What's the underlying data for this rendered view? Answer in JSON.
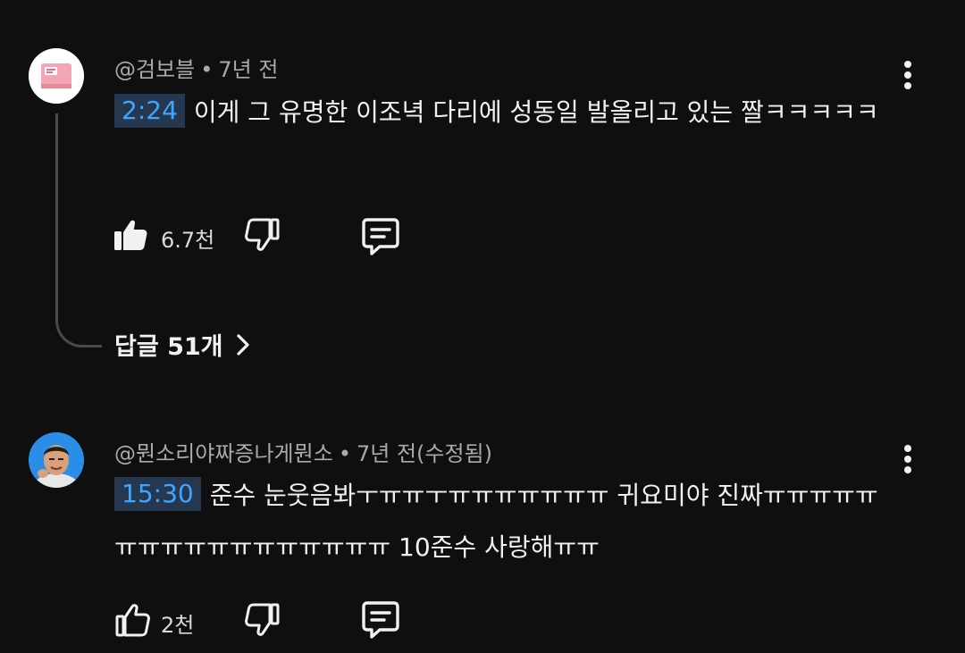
{
  "comments": [
    {
      "handle": "@검보블",
      "separator": "•",
      "age": "7년 전",
      "timestamp": "2:24",
      "text": "이게 그 유명한 이조녁 다리에 성동일 발올리고 있는 짤ㅋㅋㅋㅋㅋ",
      "likes": "6.7천",
      "like_icon": "thumbs-up-filled-icon",
      "replies_label": "답글 51개"
    },
    {
      "handle": "@뭔소리야짜증나게뭔소",
      "separator": "•",
      "age": "7년 전(수정됨)",
      "timestamp": "15:30",
      "text": "준수 눈웃음봐ㅜㅠㅠㅜㅠㅠㅠㅠㅠㅠㅠ 귀요미야 진짜ㅠㅠㅠㅠㅠㅠㅠㅠㅠㅠㅠㅠㅠㅠㅠㅠㅠ 10준수 사랑해ㅠㅠ",
      "likes": "2천",
      "like_icon": "thumbs-up-outline-icon"
    }
  ],
  "colors": {
    "background": "#0f0f0f",
    "timestamp_text": "#3ea6ff",
    "timestamp_bg": "#263850",
    "meta_text": "#aaaaaa"
  }
}
